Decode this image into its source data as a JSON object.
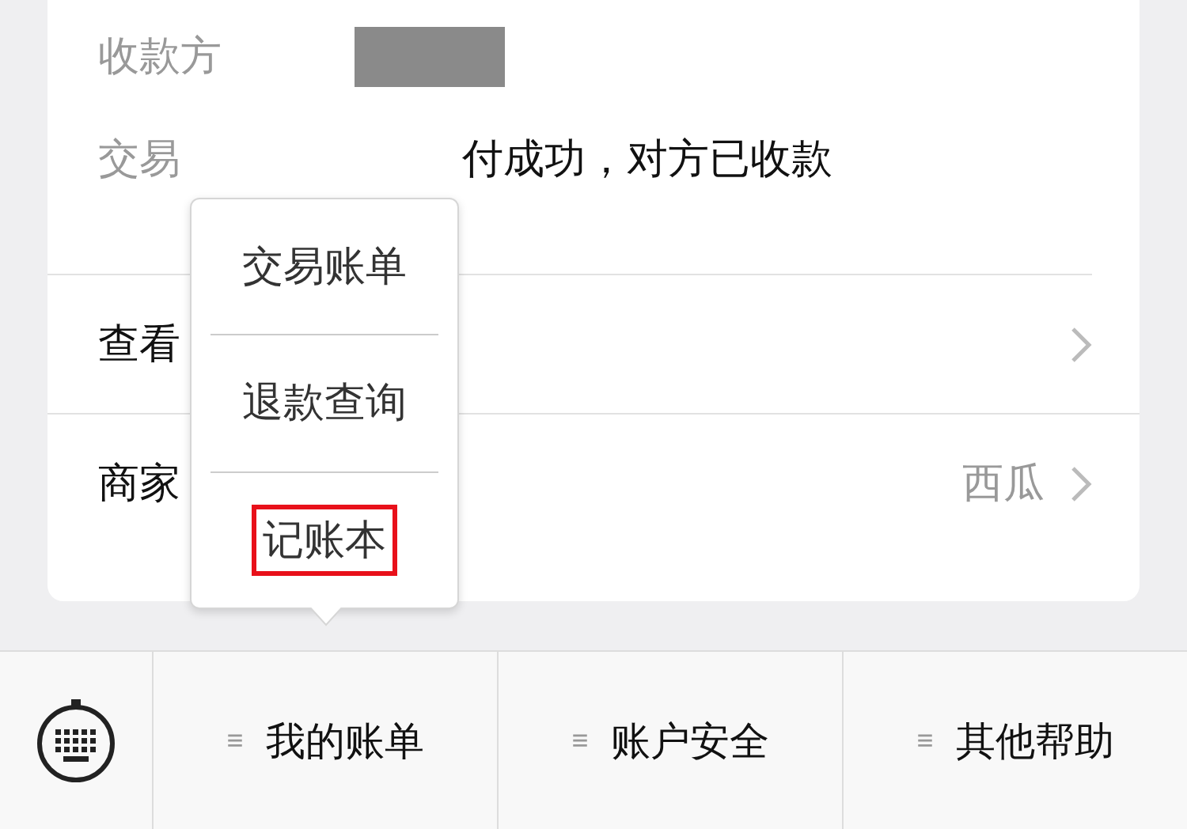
{
  "info_rows": [
    {
      "label": "收款方",
      "kind": "redacted"
    },
    {
      "label": "交易",
      "kind": "text",
      "value": "付成功，对方已收款"
    }
  ],
  "nav_rows": [
    {
      "label": "查看"
    },
    {
      "label": "商家",
      "value": "西瓜"
    }
  ],
  "popup_menu": [
    {
      "label": "交易账单",
      "highlighted": false
    },
    {
      "label": "退款查询",
      "highlighted": false
    },
    {
      "label": "记账本",
      "highlighted": true
    }
  ],
  "bottom_menu": [
    {
      "icon": "≡",
      "label": "我的账单"
    },
    {
      "icon": "≡",
      "label": "账户安全"
    },
    {
      "icon": "≡",
      "label": "其他帮助"
    }
  ]
}
